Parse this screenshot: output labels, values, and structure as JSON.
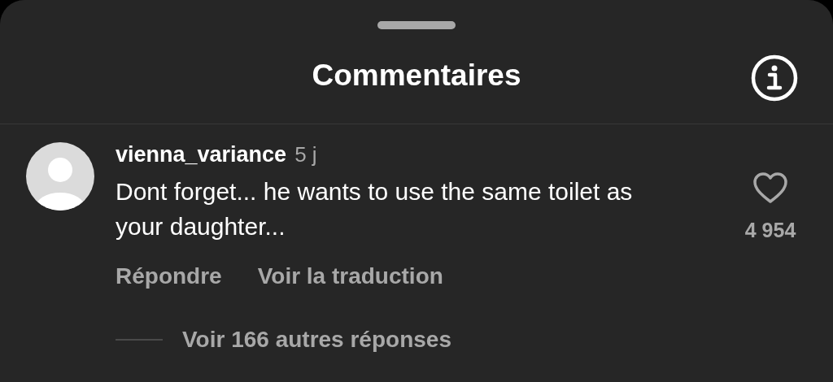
{
  "header": {
    "title": "Commentaires"
  },
  "comments": [
    {
      "username": "vienna_variance",
      "time": "5 j",
      "text": "Dont forget... he wants to use the same toilet as your daughter...",
      "liked": false,
      "likes": "4 954",
      "actions": [
        "Répondre",
        "Voir la traduction"
      ],
      "replies_link": "Voir 166 autres réponses"
    }
  ]
}
